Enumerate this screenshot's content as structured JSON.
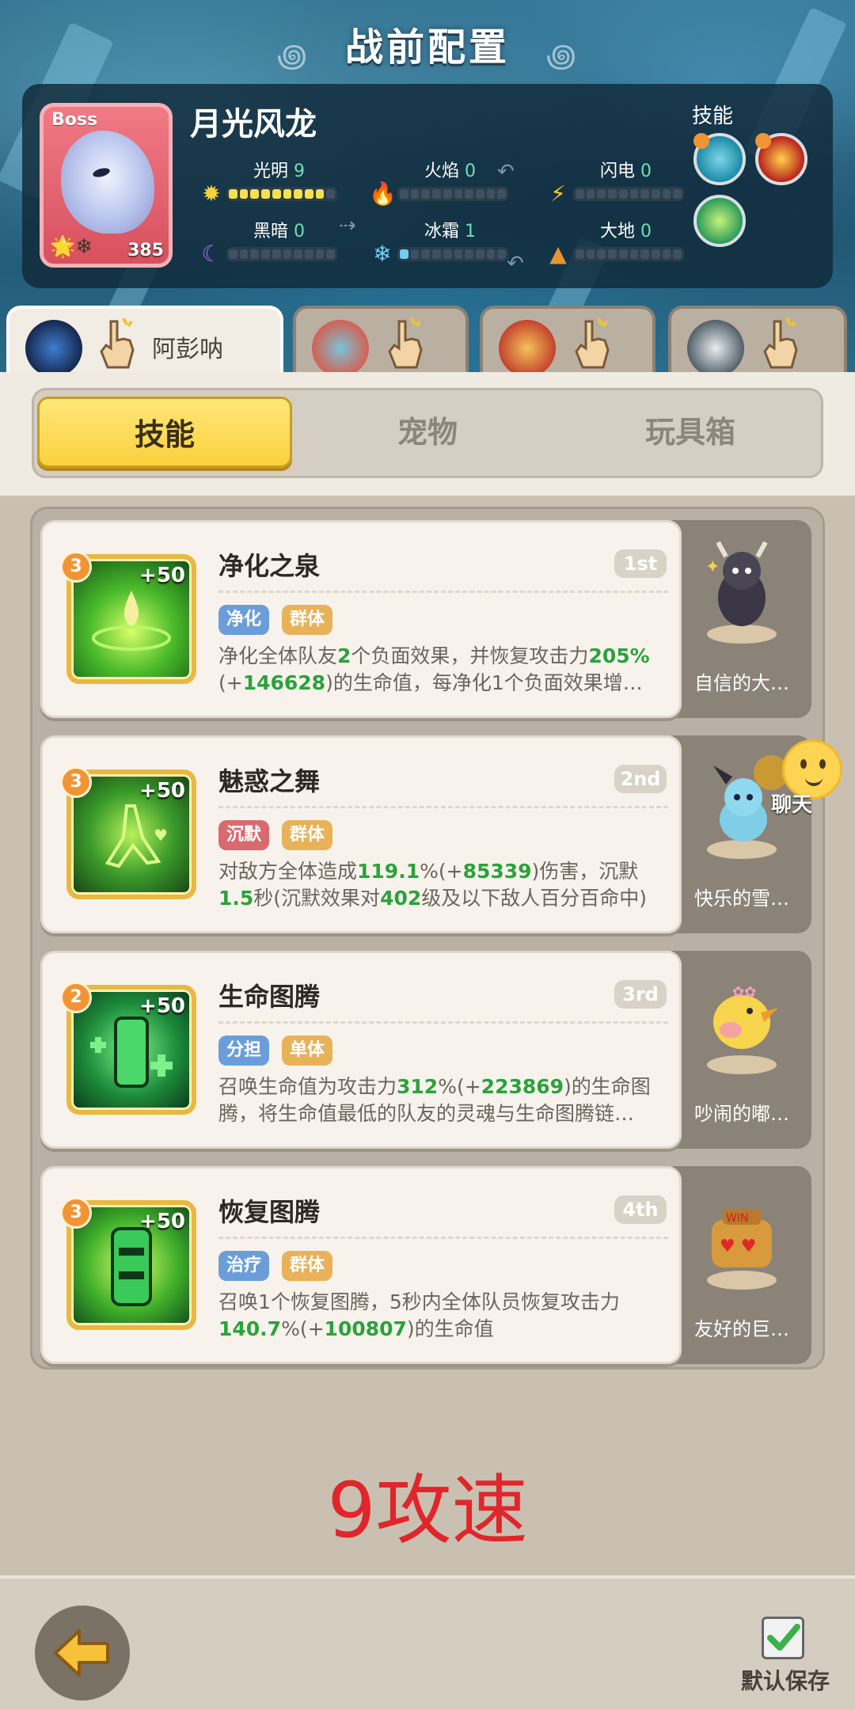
{
  "title": "战前配置",
  "boss": {
    "tag": "Boss",
    "name": "月光风龙",
    "level": "385",
    "elements": [
      {
        "name": "光明",
        "value": "9"
      },
      {
        "name": "火焰",
        "value": "0"
      },
      {
        "name": "闪电",
        "value": "0"
      },
      {
        "name": "黑暗",
        "value": "0"
      },
      {
        "name": "冰霜",
        "value": "1"
      },
      {
        "name": "大地",
        "value": "0"
      }
    ],
    "skills_label": "技能"
  },
  "hero_tabs": [
    {
      "name": "阿彭呐",
      "active": true
    },
    {
      "name": "",
      "active": false
    },
    {
      "name": "",
      "active": false
    },
    {
      "name": "",
      "active": false
    }
  ],
  "segments": {
    "skills": "技能",
    "pets": "宠物",
    "toybox": "玩具箱",
    "active": "skills"
  },
  "skills": [
    {
      "level": "3",
      "bonus": "+50",
      "name": "净化之泉",
      "rank": "1st",
      "tags": [
        "净化",
        "群体"
      ],
      "desc_parts": [
        "净化全体队友",
        "2",
        "个负面效果，并恢复攻击力",
        "205%",
        "(+",
        "146628",
        ")的生命值，每净化1个负面效果增…"
      ],
      "pet": "自信的大…"
    },
    {
      "level": "3",
      "bonus": "+50",
      "name": "魅惑之舞",
      "rank": "2nd",
      "tags": [
        "沉默",
        "群体"
      ],
      "desc_parts": [
        "对敌方全体造成",
        "119.1",
        "%(+",
        "85339",
        ")伤害，沉默",
        "1.5",
        "秒(沉默效果对",
        "402",
        "级及以下敌人百分百命中)"
      ],
      "pet": "快乐的雪…"
    },
    {
      "level": "2",
      "bonus": "+50",
      "name": "生命图腾",
      "rank": "3rd",
      "tags": [
        "分担",
        "单体"
      ],
      "desc_parts": [
        "召唤生命值为攻击力",
        "312",
        "%(+",
        "223869",
        ")的生命图腾，将生命值最低的队友的灵魂与生命图腾链…"
      ],
      "pet": "吵闹的嘟…"
    },
    {
      "level": "3",
      "bonus": "+50",
      "name": "恢复图腾",
      "rank": "4th",
      "tags": [
        "治疗",
        "群体"
      ],
      "desc_parts": [
        "召唤1个恢复图腾，5秒内全体队员恢复攻击力",
        "140.7",
        "%(+",
        "100807",
        ")的生命值"
      ],
      "pet": "友好的巨…"
    }
  ],
  "chat_label": "聊天",
  "note": "9攻速",
  "save_label": "默认保存",
  "colors": {
    "accent_yellow": "#fbd23c",
    "highlight_green": "#2ba23b",
    "note_red": "#e0262b"
  }
}
